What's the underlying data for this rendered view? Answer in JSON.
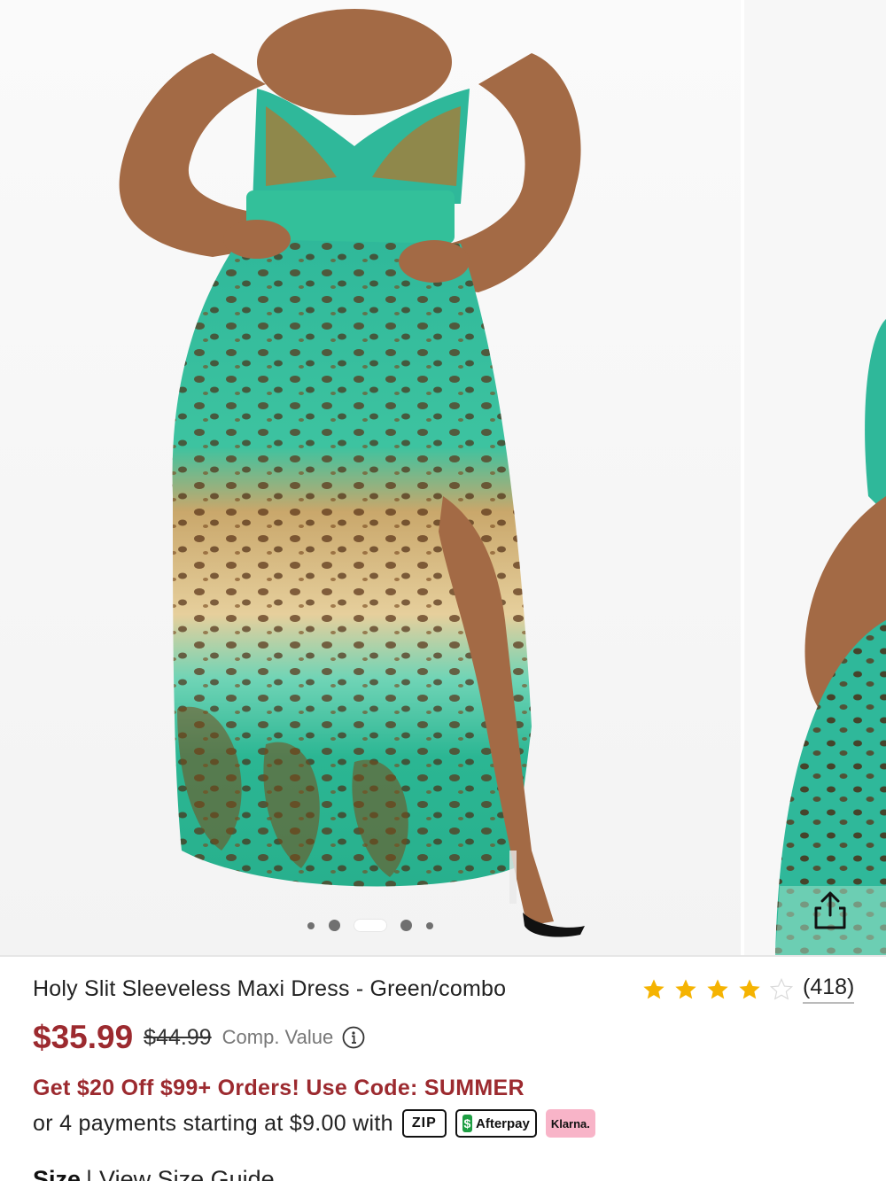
{
  "product": {
    "title": "Holy Slit Sleeveless Maxi Dress - Green/combo",
    "rating": 4,
    "rating_max": 5,
    "review_count": "(418)",
    "price": "$35.99",
    "price_original": "$44.99",
    "comp_value_label": "Comp. Value",
    "promo": "Get $20 Off $99+ Orders! Use Code: SUMMER",
    "payments_text": "or 4 payments starting at $9.00 with",
    "payment_providers": {
      "zip": "ZIP",
      "afterpay": "Afterpay",
      "klarna": "Klarna."
    },
    "size_label": "Size",
    "size_guide_label": "View Size Guide"
  },
  "gallery": {
    "total_images": 5,
    "active_index": 2
  },
  "colors": {
    "price_red": "#9c2a2f",
    "star_gold": "#f5b301",
    "dress_teal": "#2fb89a",
    "afterpay_green": "#1e9e43",
    "klarna_pink": "#f8b4c8"
  },
  "icons": [
    "share-icon",
    "star-icon",
    "info-icon"
  ]
}
